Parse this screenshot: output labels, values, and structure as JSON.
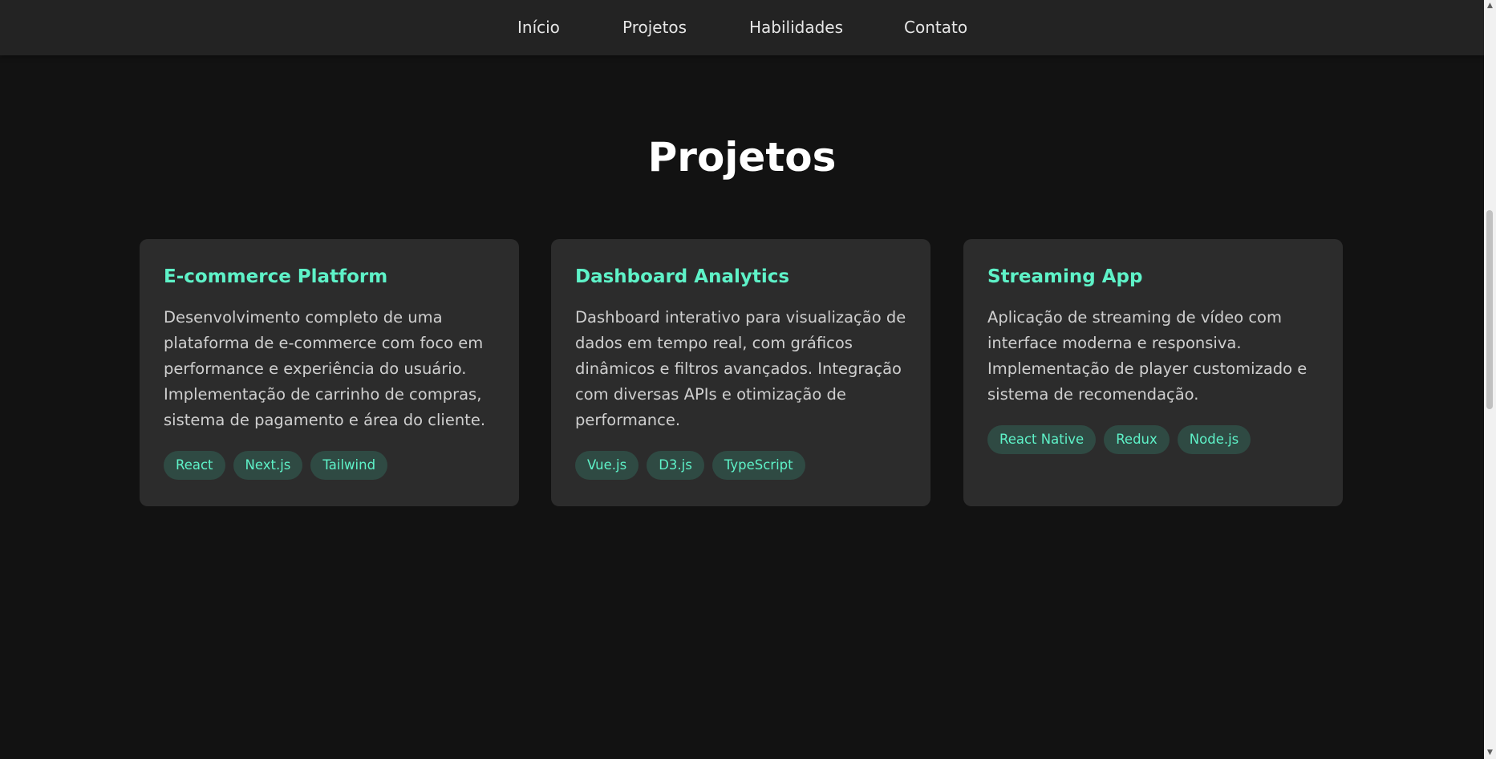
{
  "nav": {
    "items": [
      {
        "label": "Início"
      },
      {
        "label": "Projetos"
      },
      {
        "label": "Habilidades"
      },
      {
        "label": "Contato"
      }
    ]
  },
  "projects": {
    "title": "Projetos",
    "cards": [
      {
        "title": "E-commerce Platform",
        "description": "Desenvolvimento completo de uma plataforma de e-commerce com foco em performance e experiência do usuário. Implementação de carrinho de compras, sistema de pagamento e área do cliente.",
        "tags": [
          "React",
          "Next.js",
          "Tailwind"
        ]
      },
      {
        "title": "Dashboard Analytics",
        "description": "Dashboard interativo para visualização de dados em tempo real, com gráficos dinâmicos e filtros avançados. Integração com diversas APIs e otimização de performance.",
        "tags": [
          "Vue.js",
          "D3.js",
          "TypeScript"
        ]
      },
      {
        "title": "Streaming App",
        "description": "Aplicação de streaming de vídeo com interface moderna e responsiva. Implementação de player customizado e sistema de recomendação.",
        "tags": [
          "React Native",
          "Redux",
          "Node.js"
        ]
      }
    ]
  },
  "colors": {
    "background": "#121212",
    "navbar": "#232323",
    "card": "#2c2c2c",
    "accent": "#5ef2c8",
    "tag_background": "#2f4a43"
  },
  "icons": {
    "scroll_up": "scroll-up-arrow-icon",
    "scroll_down": "scroll-down-arrow-icon"
  }
}
